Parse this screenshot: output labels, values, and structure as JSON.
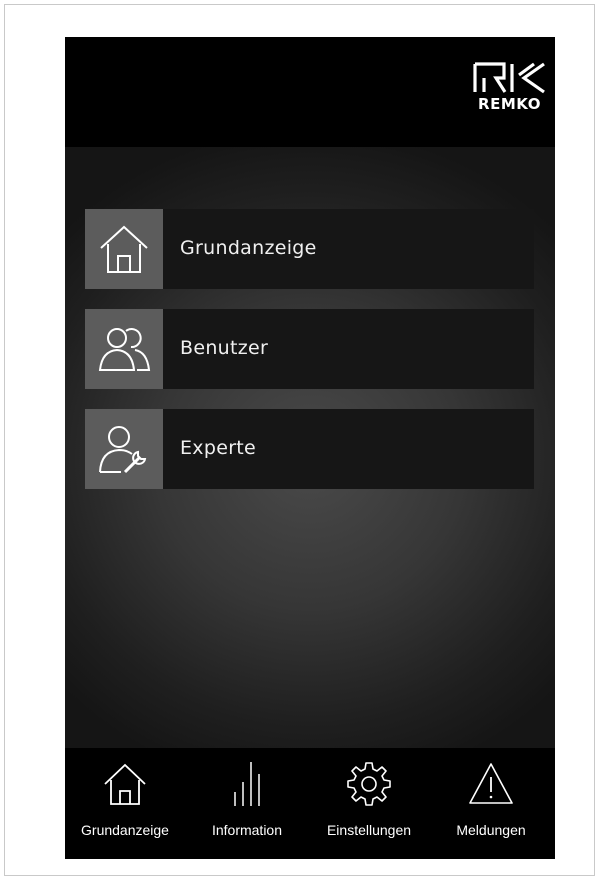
{
  "brand": {
    "logo_text": "REMKO"
  },
  "menu": {
    "items": [
      {
        "label": "Grundanzeige",
        "icon": "home-icon"
      },
      {
        "label": "Benutzer",
        "icon": "users-icon"
      },
      {
        "label": "Experte",
        "icon": "expert-icon"
      }
    ]
  },
  "nav": {
    "items": [
      {
        "label": "Grundanzeige",
        "icon": "home-icon"
      },
      {
        "label": "Information",
        "icon": "bars-icon"
      },
      {
        "label": "Einstellungen",
        "icon": "gear-icon"
      },
      {
        "label": "Meldungen",
        "icon": "warning-icon"
      }
    ]
  },
  "colors": {
    "background": "#000000",
    "tile": "#161616",
    "icon_box": "#5c5c5c",
    "text": "#ffffff"
  }
}
